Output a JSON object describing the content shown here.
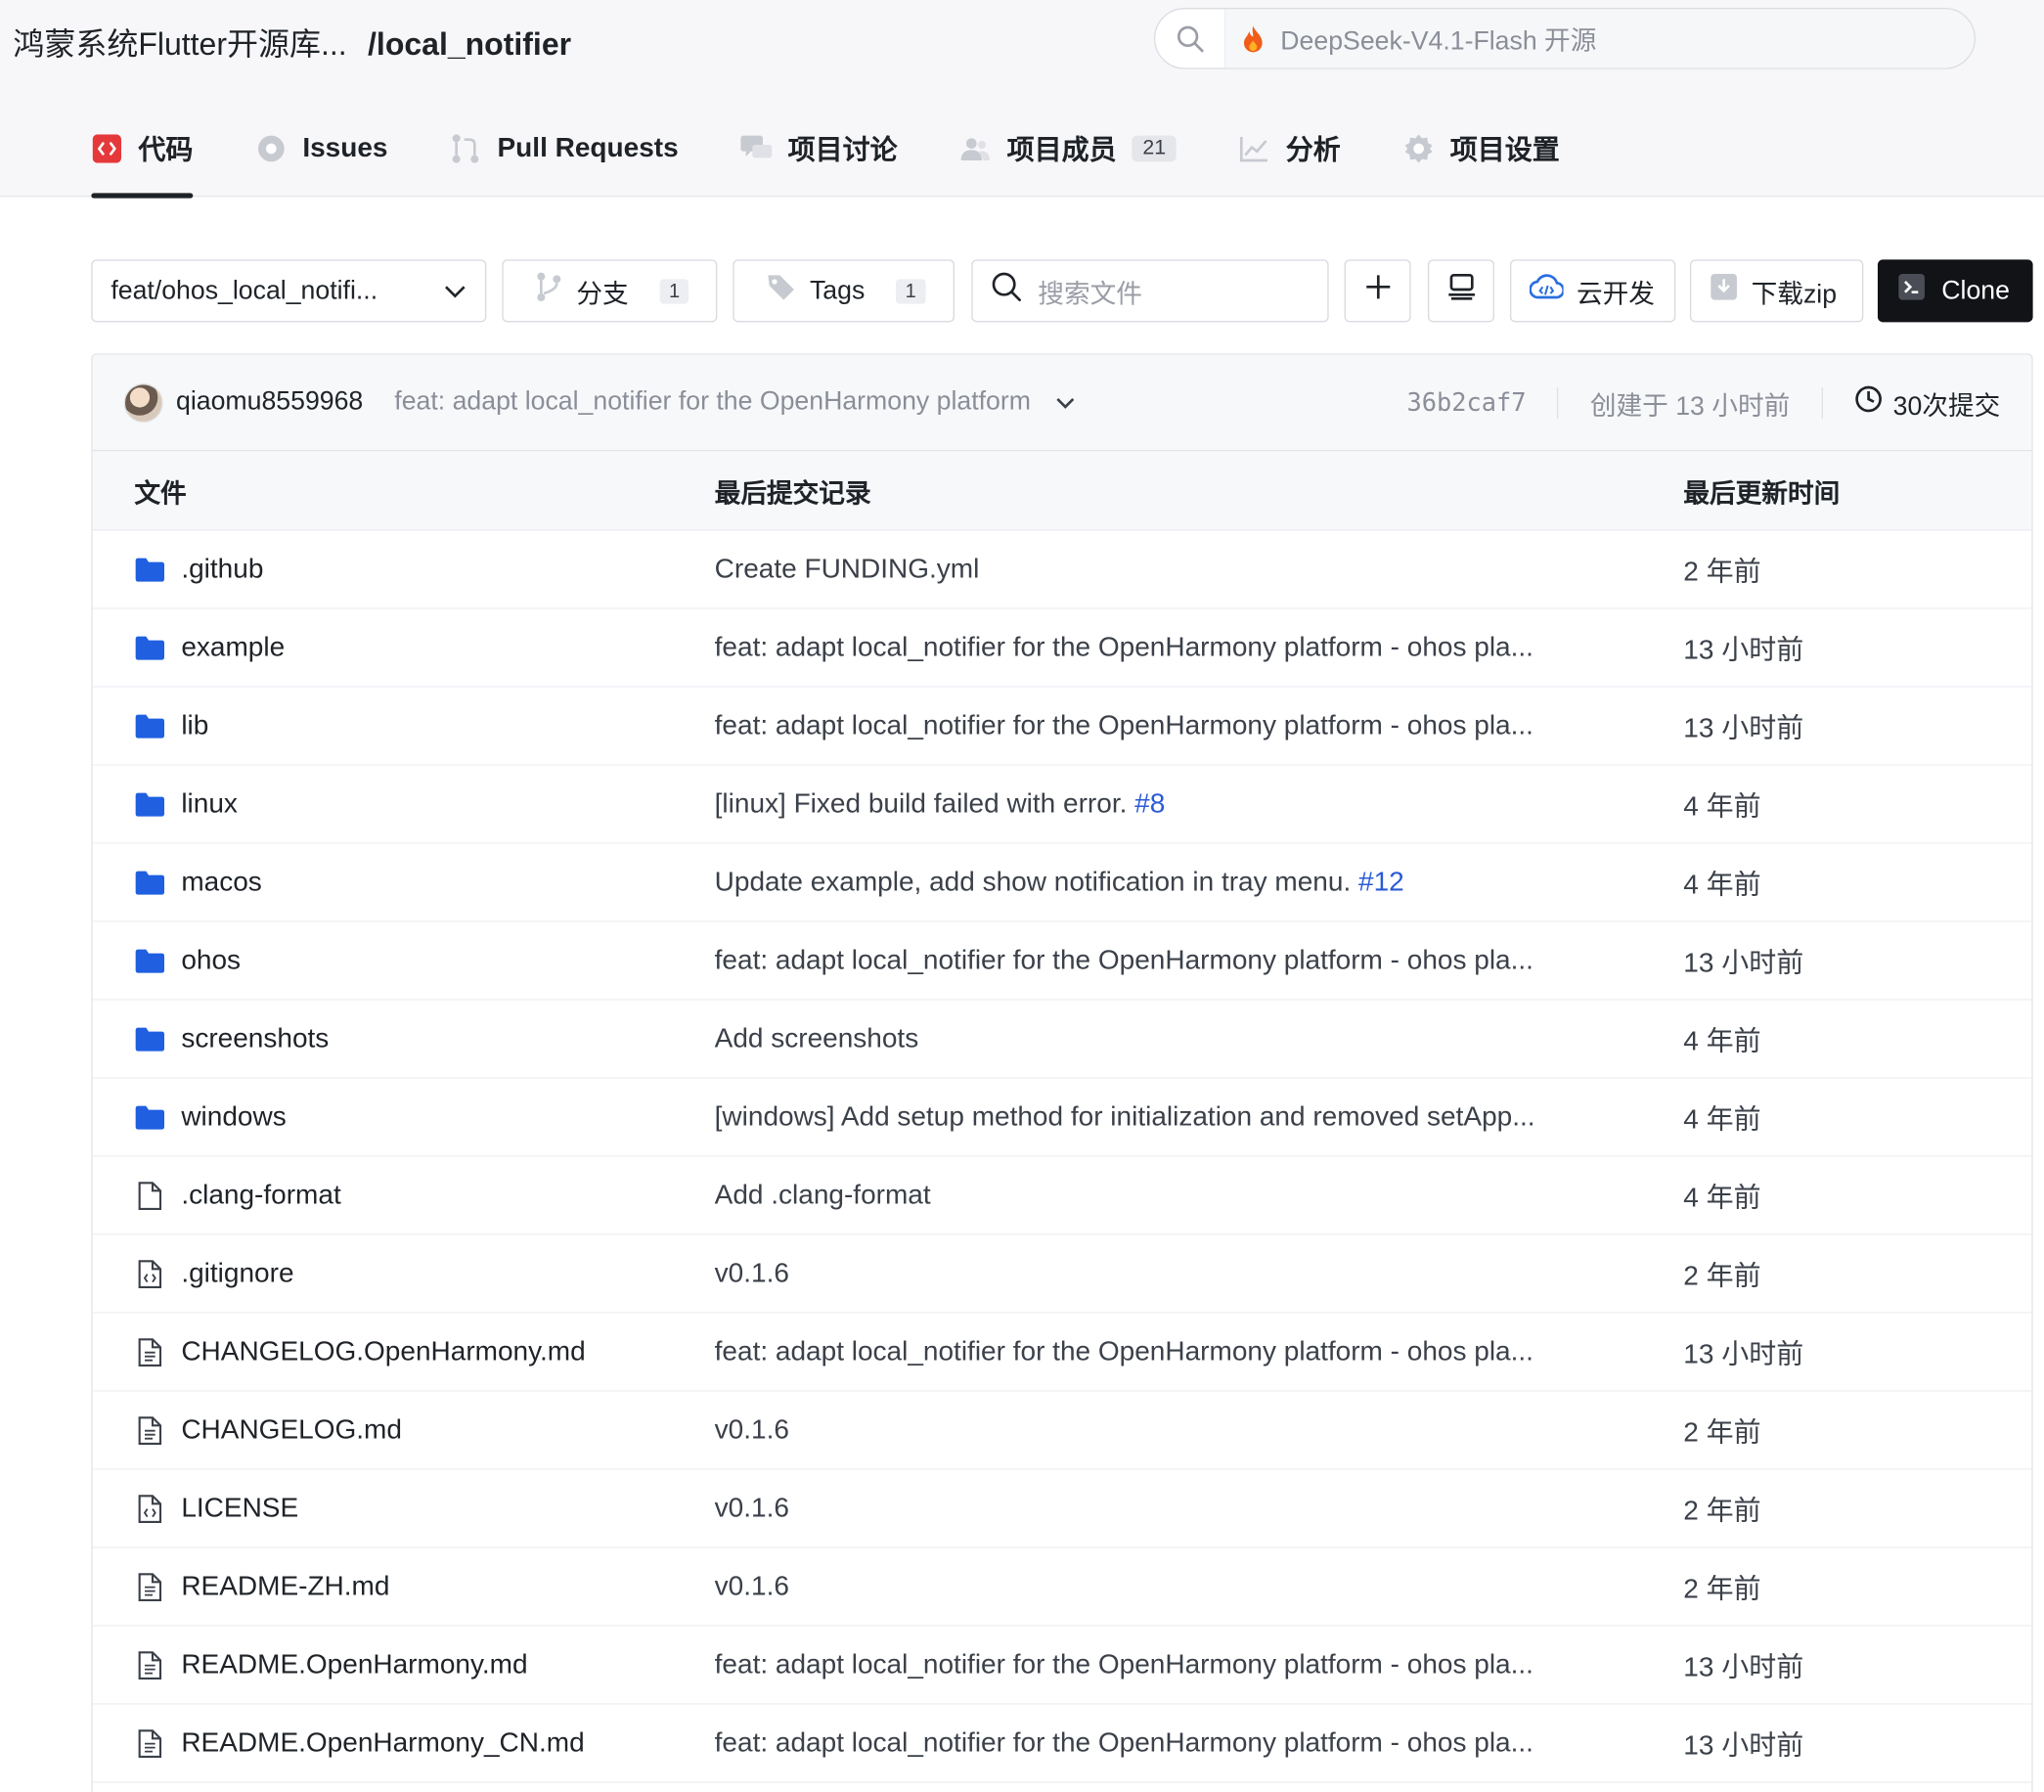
{
  "header": {
    "org": "鸿蒙系统Flutter开源库...",
    "repo": "/local_notifier",
    "search_hint": "DeepSeek-V4.1-Flash 开源"
  },
  "tabs": [
    {
      "label": "代码",
      "icon": "code-icon",
      "active": true
    },
    {
      "label": "Issues",
      "icon": "issue-icon"
    },
    {
      "label": "Pull Requests",
      "icon": "pull-request-icon"
    },
    {
      "label": "项目讨论",
      "icon": "discussion-icon"
    },
    {
      "label": "项目成员",
      "icon": "members-icon",
      "count": "21"
    },
    {
      "label": "分析",
      "icon": "chart-icon"
    },
    {
      "label": "项目设置",
      "icon": "settings-gear-icon"
    }
  ],
  "toolbar": {
    "branch": "feat/ohos_local_notifi...",
    "branches_label": "分支",
    "branches_count": "1",
    "tags_label": "Tags",
    "tags_count": "1",
    "search_placeholder": "搜索文件",
    "cloud_label": "云开发",
    "zip_label": "下载zip",
    "clone_label": "Clone"
  },
  "commit": {
    "author": "qiaomu8559968",
    "message": "feat: adapt local_notifier for the OpenHarmony platform",
    "sha": "36b2caf7",
    "created": "创建于 13 小时前",
    "commits": "30次提交"
  },
  "table": {
    "headers": [
      "文件",
      "最后提交记录",
      "最后更新时间"
    ],
    "rows": [
      {
        "name": ".github",
        "type": "folder",
        "msg": "Create FUNDING.yml",
        "time": "2 年前"
      },
      {
        "name": "example",
        "type": "folder",
        "msg": "feat: adapt local_notifier for the OpenHarmony platform - ohos pla...",
        "time": "13 小时前"
      },
      {
        "name": "lib",
        "type": "folder",
        "msg": "feat: adapt local_notifier for the OpenHarmony platform - ohos pla...",
        "time": "13 小时前"
      },
      {
        "name": "linux",
        "type": "folder",
        "msg": "[linux] Fixed build failed with error.",
        "link": "#8",
        "time": "4 年前"
      },
      {
        "name": "macos",
        "type": "folder",
        "msg": "Update example, add show notification in tray menu.",
        "link": "#12",
        "time": "4 年前"
      },
      {
        "name": "ohos",
        "type": "folder",
        "msg": "feat: adapt local_notifier for the OpenHarmony platform - ohos pla...",
        "time": "13 小时前"
      },
      {
        "name": "screenshots",
        "type": "folder",
        "msg": "Add screenshots",
        "time": "4 年前"
      },
      {
        "name": "windows",
        "type": "folder",
        "msg": "[windows] Add setup method for initialization and removed setApp...",
        "time": "4 年前"
      },
      {
        "name": ".clang-format",
        "type": "file",
        "msg": "Add .clang-format",
        "time": "4 年前"
      },
      {
        "name": ".gitignore",
        "type": "code",
        "msg": "v0.1.6",
        "time": "2 年前"
      },
      {
        "name": "CHANGELOG.OpenHarmony.md",
        "type": "doc",
        "msg": "feat: adapt local_notifier for the OpenHarmony platform - ohos pla...",
        "time": "13 小时前"
      },
      {
        "name": "CHANGELOG.md",
        "type": "doc",
        "msg": "v0.1.6",
        "time": "2 年前"
      },
      {
        "name": "LICENSE",
        "type": "code",
        "msg": "v0.1.6",
        "time": "2 年前"
      },
      {
        "name": "README-ZH.md",
        "type": "doc",
        "msg": "v0.1.6",
        "time": "2 年前"
      },
      {
        "name": "README.OpenHarmony.md",
        "type": "doc",
        "msg": "feat: adapt local_notifier for the OpenHarmony platform - ohos pla...",
        "time": "13 小时前"
      },
      {
        "name": "README.OpenHarmony_CN.md",
        "type": "doc",
        "msg": "feat: adapt local_notifier for the OpenHarmony platform - ohos pla...",
        "time": "13 小时前"
      }
    ]
  },
  "colors": {
    "folder": "#1f5fe0",
    "accent_link": "#2a5ad6",
    "code_tab": "#e5383b",
    "clone_bg": "#111317"
  }
}
